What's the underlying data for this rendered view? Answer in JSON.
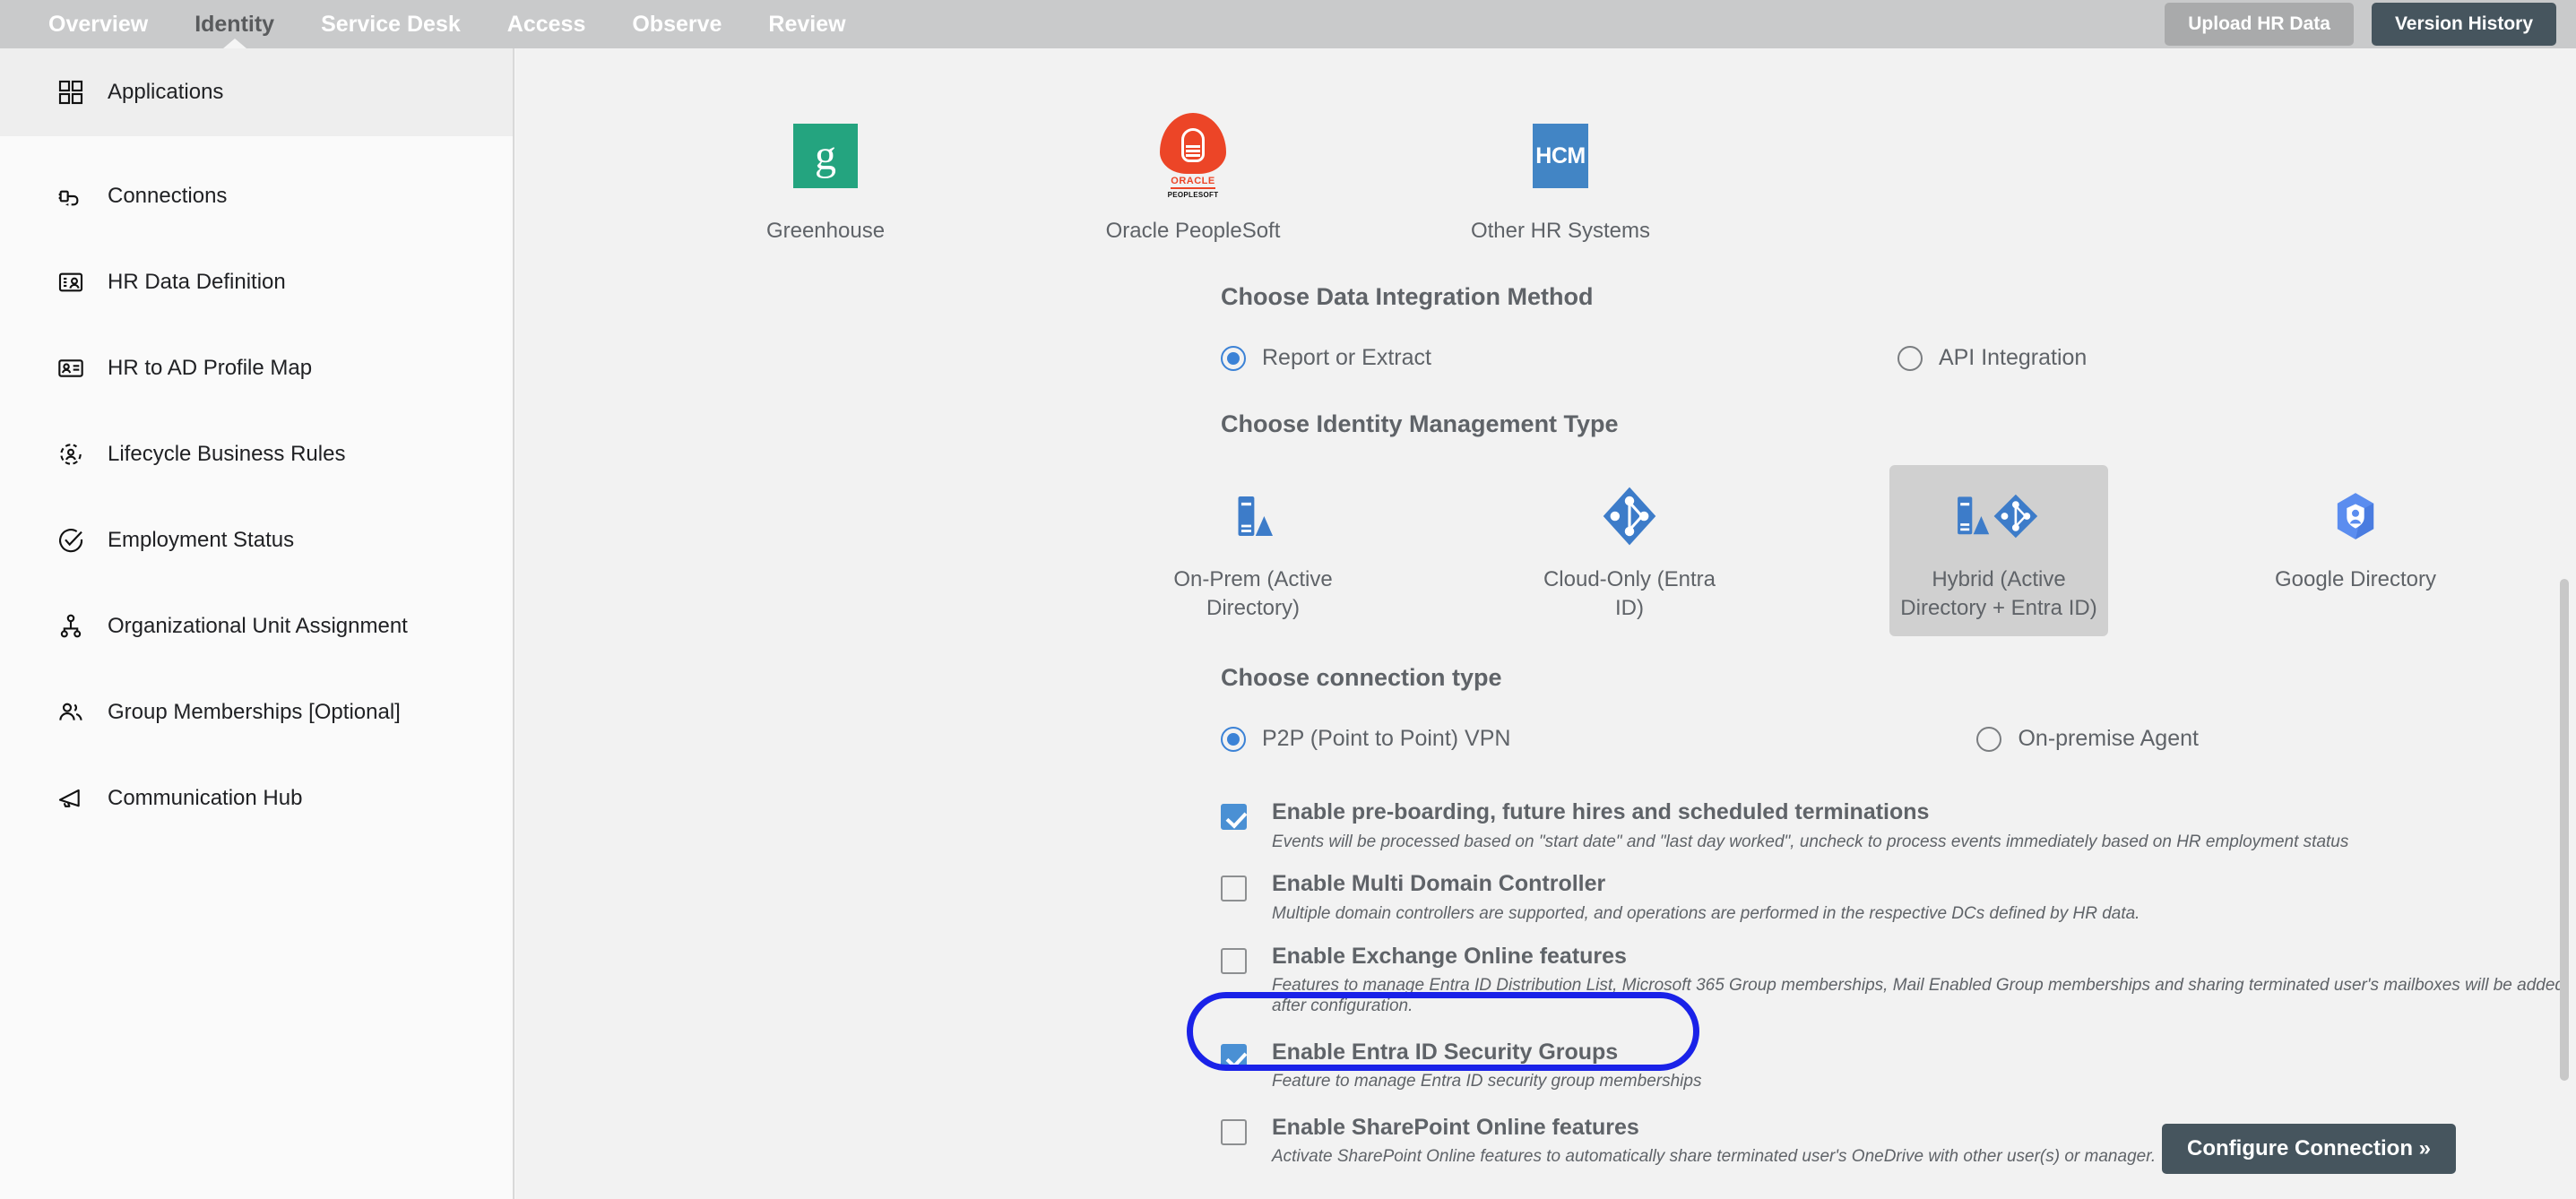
{
  "topnav": {
    "tabs": [
      {
        "label": "Overview",
        "active": false
      },
      {
        "label": "Identity",
        "active": true
      },
      {
        "label": "Service Desk",
        "active": false
      },
      {
        "label": "Access",
        "active": false
      },
      {
        "label": "Observe",
        "active": false
      },
      {
        "label": "Review",
        "active": false
      }
    ],
    "upload_button": "Upload HR Data",
    "version_button": "Version History",
    "bar_color": "#c9cacb",
    "active_tab_color": "#595b5d",
    "version_button_color": "#46555e"
  },
  "sidebar": {
    "items": [
      {
        "label": "Applications",
        "icon": "grid-icon",
        "active": true
      },
      {
        "label": "Connections",
        "icon": "plug-icon",
        "active": false
      },
      {
        "label": "HR Data Definition",
        "icon": "id-card-icon",
        "active": false
      },
      {
        "label": "HR to AD Profile Map",
        "icon": "contact-card-icon",
        "active": false
      },
      {
        "label": "Lifecycle Business Rules",
        "icon": "user-cycle-icon",
        "active": false
      },
      {
        "label": "Employment Status",
        "icon": "check-circle-icon",
        "active": false
      },
      {
        "label": "Organizational Unit Assignment",
        "icon": "org-chart-icon",
        "active": false
      },
      {
        "label": "Group Memberships [Optional]",
        "icon": "users-icon",
        "active": false
      },
      {
        "label": "Communication Hub",
        "icon": "megaphone-icon",
        "active": false
      }
    ]
  },
  "main": {
    "hr_systems": [
      {
        "name": "Greenhouse",
        "icon": "greenhouse-logo",
        "glyph": "g",
        "color": "#24a47f"
      },
      {
        "name": "Oracle PeopleSoft",
        "icon": "oracle-peoplesoft-logo",
        "word": "ORACLE",
        "sub": "PEOPLESOFT",
        "color": "#ec4527"
      },
      {
        "name": "Other HR Systems",
        "icon": "hcm-logo",
        "glyph": "HCM",
        "color": "#4285c5"
      }
    ],
    "integration_method": {
      "title": "Choose Data Integration Method",
      "options": [
        {
          "label": "Report or Extract",
          "selected": true
        },
        {
          "label": "API Integration",
          "selected": false
        }
      ]
    },
    "identity_type": {
      "title": "Choose Identity Management Type",
      "options": [
        {
          "label": "On-Prem (Active Directory)",
          "icon": "server-icon",
          "selected": false
        },
        {
          "label": "Cloud-Only (Entra ID)",
          "icon": "entra-id-icon",
          "selected": false
        },
        {
          "label": "Hybrid (Active Directory + Entra ID)",
          "icon": "hybrid-ad-entra-icon",
          "selected": true
        },
        {
          "label": "Google Directory",
          "icon": "google-directory-icon",
          "selected": false
        }
      ]
    },
    "connection_type": {
      "title": "Choose connection type",
      "options": [
        {
          "label": "P2P (Point to Point) VPN",
          "selected": true
        },
        {
          "label": "On-premise Agent",
          "selected": false
        }
      ]
    },
    "features": [
      {
        "title": "Enable pre-boarding, future hires and scheduled terminations",
        "desc": "Events will be processed based on \"start date\" and \"last day worked\", uncheck to process events immediately based on HR employment status",
        "checked": true
      },
      {
        "title": "Enable Multi Domain Controller",
        "desc": "Multiple domain controllers are supported, and operations are performed in the respective DCs defined by HR data.",
        "checked": false
      },
      {
        "title": "Enable Exchange Online features",
        "desc": "Features to manage Entra ID Distribution List, Microsoft 365 Group memberships, Mail Enabled Group memberships and sharing terminated user's mailboxes will be added after configuration.",
        "checked": false
      },
      {
        "title": "Enable Entra ID Security Groups",
        "desc": "Feature to manage Entra ID security group memberships",
        "checked": true,
        "highlighted": true
      },
      {
        "title": "Enable SharePoint Online features",
        "desc": "Activate SharePoint Online features to automatically share terminated user's OneDrive with other user(s) or manager.",
        "checked": false
      }
    ],
    "configure_button": "Configure Connection »",
    "highlight_color": "#1a22e8",
    "checkbox_checked_color": "#4a90d4",
    "radio_checked_color": "#3b82d6"
  }
}
